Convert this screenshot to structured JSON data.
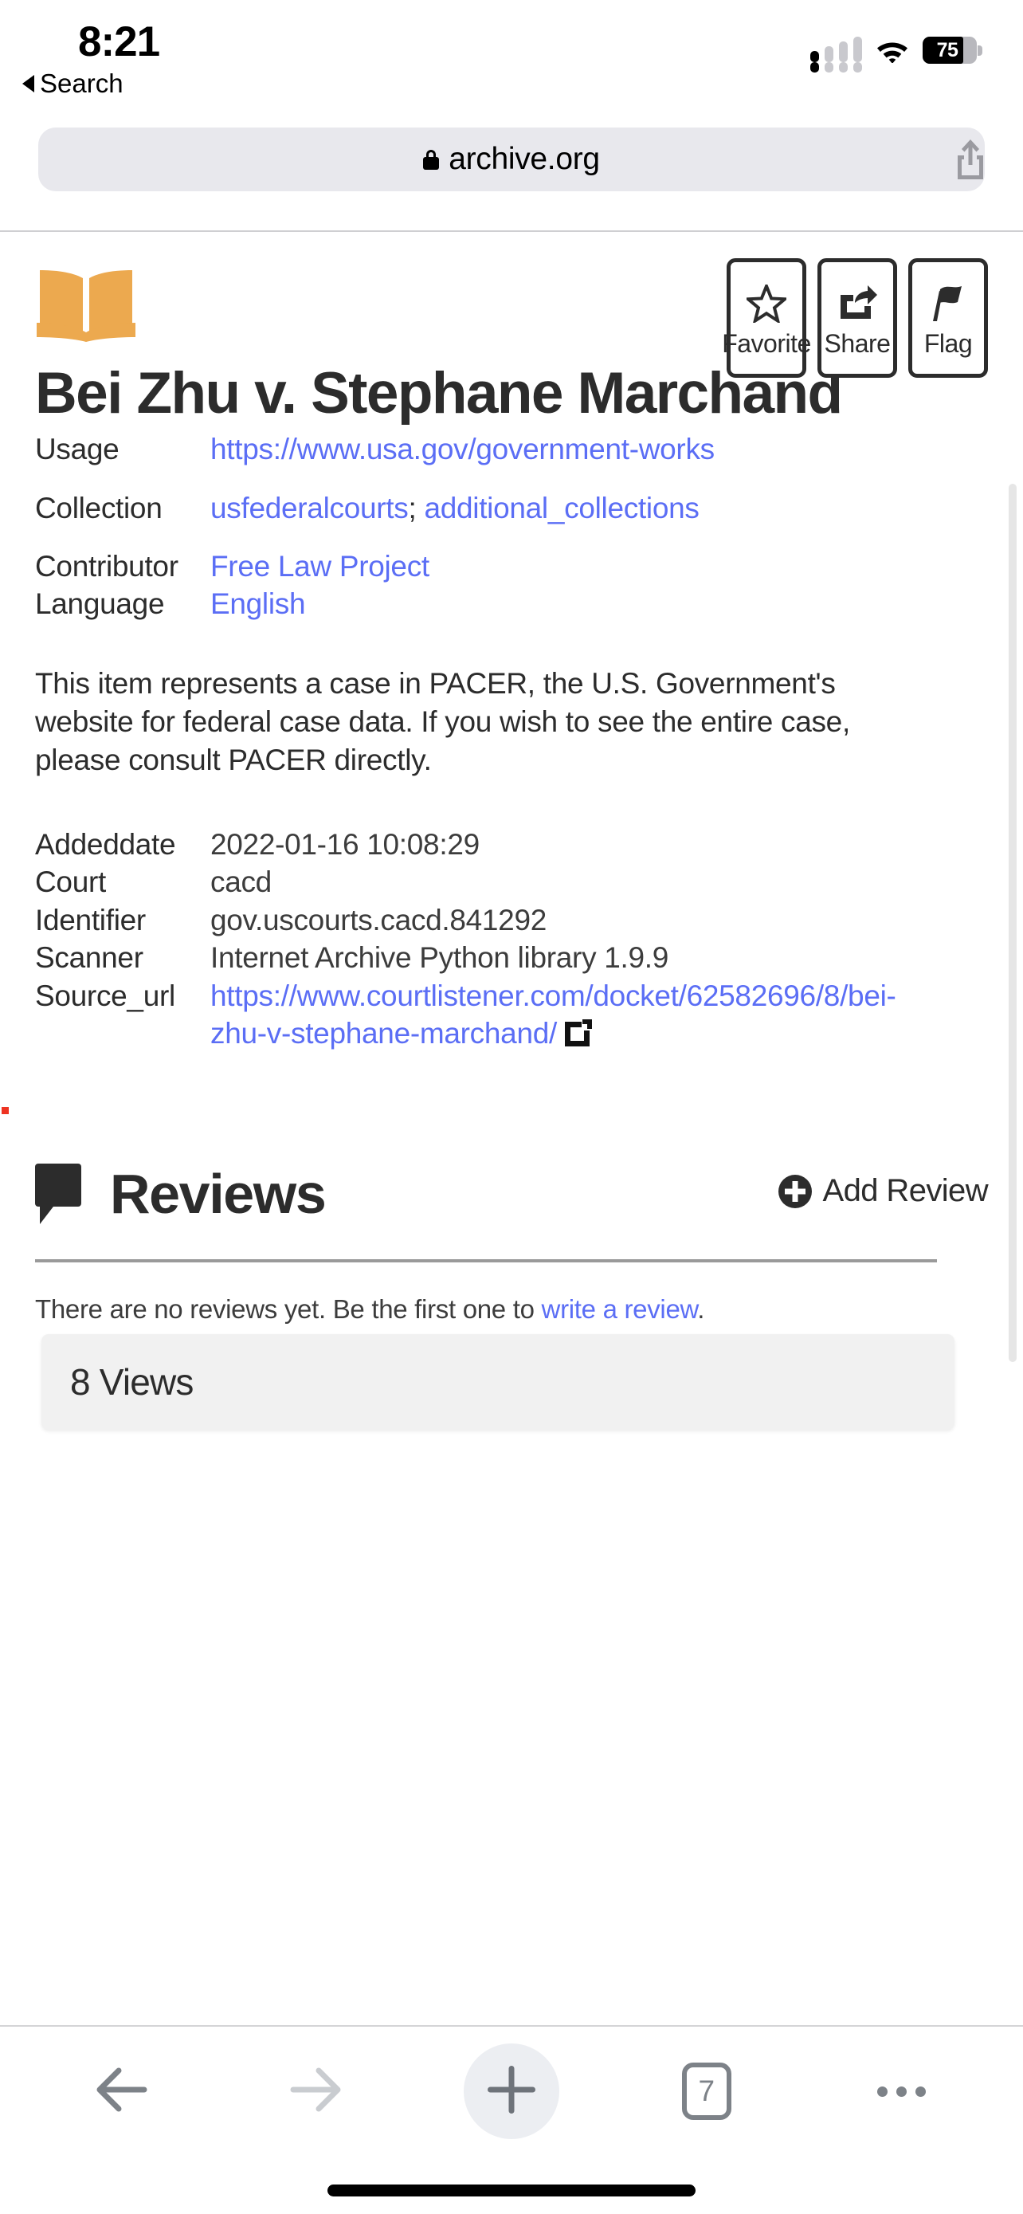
{
  "status_bar": {
    "time": "8:21",
    "battery_percent": "75",
    "battery_level": 75,
    "cellular_icon": "cellular-signal-icon",
    "wifi_icon": "wifi-icon",
    "battery_icon": "battery-icon"
  },
  "back_link": {
    "label": "Search",
    "icon": "back-triangle-icon"
  },
  "browser": {
    "url": "archive.org",
    "lock_icon": "lock-icon",
    "share_icon": "share-ios-icon"
  },
  "header": {
    "logo_icon": "open-book-icon",
    "logo_color": "#eca94f",
    "buttons": [
      {
        "label": "Favorite",
        "icon": "star-outline-icon"
      },
      {
        "label": "Share",
        "icon": "share-arrow-icon"
      },
      {
        "label": "Flag",
        "icon": "flag-icon"
      }
    ]
  },
  "item": {
    "title": "Bei Zhu v. Stephane Marchand",
    "metadata_top": [
      {
        "key": "Usage",
        "value": "https://www.usa.gov/government-works",
        "link": true
      },
      {
        "key": "Collection",
        "value": "usfederalcourts; additional_collections",
        "link": true,
        "parts": [
          {
            "text": "usfederalcourts",
            "link": true
          },
          {
            "text": "; ",
            "link": false
          },
          {
            "text": "additional_collections",
            "link": true
          }
        ]
      },
      {
        "key": "Contributor",
        "value": "Free Law Project",
        "link": true
      },
      {
        "key": "Language",
        "value": "English",
        "link": true
      }
    ],
    "description": "This item represents a case in PACER, the U.S. Government's website for federal case data. If you wish to see the entire case, please consult PACER directly.",
    "metadata_bottom": [
      {
        "key": "Addeddate",
        "value": "2022-01-16 10:08:29",
        "link": false
      },
      {
        "key": "Court",
        "value": "cacd",
        "link": false
      },
      {
        "key": "Identifier",
        "value": "gov.uscourts.cacd.841292",
        "link": false
      },
      {
        "key": "Scanner",
        "value": "Internet Archive Python library 1.9.9",
        "link": false
      },
      {
        "key": "Source_url",
        "value": "https://www.courtlistener.com/docket/62582696/8/bei-zhu-v-stephane-marchand/",
        "link": true,
        "external_icon": "external-link-icon"
      }
    ]
  },
  "reviews": {
    "icon": "speech-bubble-icon",
    "title": "Reviews",
    "add_review_label": "Add Review",
    "add_review_icon": "plus-circle-icon",
    "empty_prefix": "There are no reviews yet. Be the first one to ",
    "empty_link": "write a review",
    "empty_suffix": "."
  },
  "views": {
    "label": "8 Views",
    "count": 8
  },
  "toolbar": {
    "back_icon": "arrow-left-icon",
    "forward_icon": "arrow-right-icon",
    "new_tab_icon": "plus-icon",
    "tabs_count": "7",
    "more_icon": "ellipsis-icon"
  },
  "colors": {
    "link": "#5b6ef5",
    "accent": "#eca94f",
    "text": "#2c2c2c",
    "chrome_bg": "#e8e8ed"
  }
}
